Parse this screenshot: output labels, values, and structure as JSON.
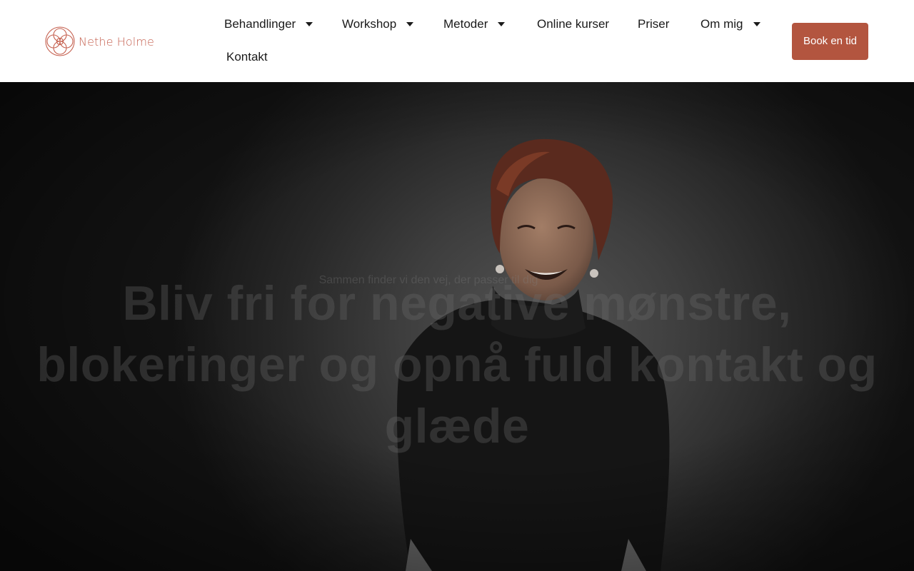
{
  "header": {
    "logo": {
      "name": "Nethe Holme",
      "icon": "flower-of-life-logo-icon",
      "color": "#c5604f"
    },
    "nav": [
      {
        "label": "Behandlinger",
        "has_dropdown": true,
        "icon": "caret-down-icon"
      },
      {
        "label": "Workshop",
        "has_dropdown": true,
        "icon": "caret-down-icon"
      },
      {
        "label": "Metoder",
        "has_dropdown": true,
        "icon": "caret-down-icon"
      },
      {
        "label": "Online kurser",
        "has_dropdown": false
      },
      {
        "label": "Priser",
        "has_dropdown": false
      },
      {
        "label": "Om mig",
        "has_dropdown": true,
        "icon": "caret-down-icon"
      },
      {
        "label": "Kontakt",
        "has_dropdown": false
      }
    ],
    "cta": {
      "label": "Book en tid",
      "color": "#b3553f"
    }
  },
  "hero": {
    "title": "Bliv fri for negative mønstre, blokeringer og opnå fuld kontakt og glæde",
    "subtitle": "Sammen finder vi den vej, der passer til dig"
  }
}
